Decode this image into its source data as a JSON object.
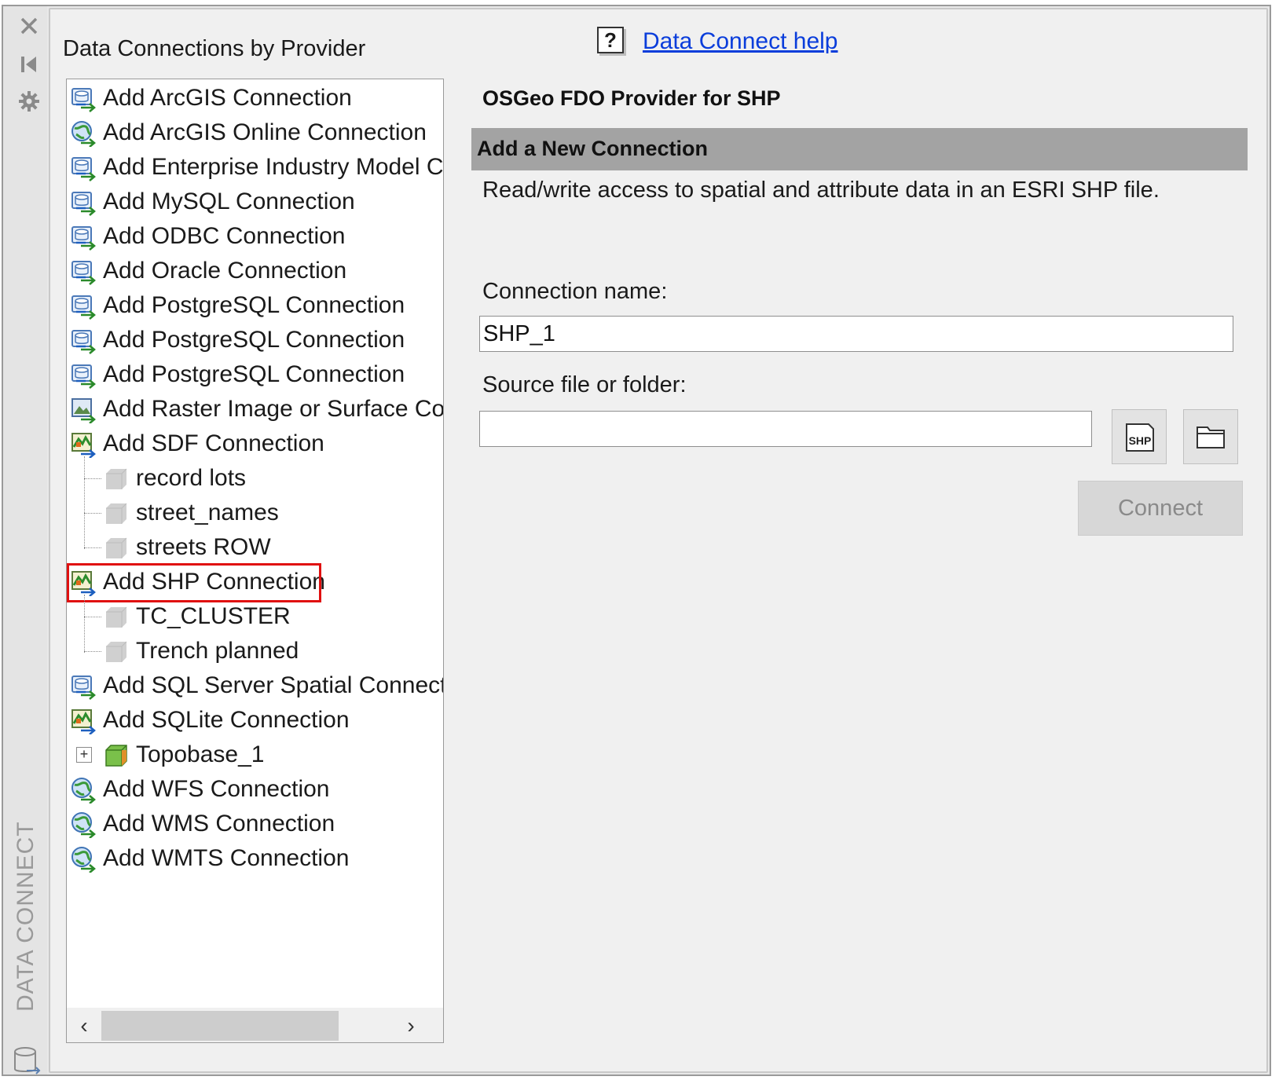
{
  "sidebar": {
    "vertical_title": "DATA CONNECT",
    "close_glyph": "✕"
  },
  "panel": {
    "title": "Data Connections by Provider",
    "help_glyph": "?",
    "help_link": "Data Connect help"
  },
  "tree": {
    "items": [
      {
        "label": "Add ArcGIS Connection",
        "icon": "db-connection-icon",
        "level": 0
      },
      {
        "label": "Add ArcGIS Online Connection",
        "icon": "globe-connection-icon",
        "level": 0
      },
      {
        "label": "Add Enterprise Industry Model C",
        "icon": "db-connection-icon",
        "level": 0
      },
      {
        "label": "Add MySQL Connection",
        "icon": "db-connection-icon",
        "level": 0
      },
      {
        "label": "Add ODBC Connection",
        "icon": "db-connection-icon",
        "level": 0
      },
      {
        "label": "Add Oracle Connection",
        "icon": "db-connection-icon",
        "level": 0
      },
      {
        "label": "Add PostgreSQL Connection",
        "icon": "db-connection-icon",
        "level": 0
      },
      {
        "label": "Add PostgreSQL Connection",
        "icon": "db-connection-icon",
        "level": 0
      },
      {
        "label": "Add PostgreSQL Connection",
        "icon": "db-connection-icon",
        "level": 0
      },
      {
        "label": "Add Raster Image or Surface Cor",
        "icon": "raster-connection-icon",
        "level": 0
      },
      {
        "label": "Add SDF Connection",
        "icon": "file-connection-icon",
        "level": 0
      },
      {
        "label": "record lots",
        "icon": "layer-cube-icon",
        "level": 1
      },
      {
        "label": "street_names",
        "icon": "layer-cube-icon",
        "level": 1
      },
      {
        "label": "streets ROW",
        "icon": "layer-cube-icon",
        "level": 1
      },
      {
        "label": "Add SHP Connection",
        "icon": "file-connection-icon",
        "level": 0,
        "selected": true
      },
      {
        "label": "TC_CLUSTER",
        "icon": "layer-cube-icon",
        "level": 1
      },
      {
        "label": "Trench planned",
        "icon": "layer-cube-icon",
        "level": 1
      },
      {
        "label": "Add SQL Server Spatial Connecti",
        "icon": "db-connection-icon",
        "level": 0
      },
      {
        "label": "Add SQLite Connection",
        "icon": "file-connection-icon",
        "level": 0
      },
      {
        "label": "Topobase_1",
        "icon": "green-cube-icon",
        "level": 1,
        "expander": "+"
      },
      {
        "label": "Add WFS Connection",
        "icon": "globe-connection-icon",
        "level": 0
      },
      {
        "label": "Add WMS Connection",
        "icon": "globe-connection-icon",
        "level": 0
      },
      {
        "label": "Add WMTS Connection",
        "icon": "globe-connection-icon",
        "level": 0
      }
    ],
    "scroll_left": "‹",
    "scroll_right": "›"
  },
  "detail": {
    "provider_title": "OSGeo FDO Provider for SHP",
    "section_title": "Add a New Connection",
    "description": "Read/write access to spatial and attribute data in an ESRI SHP file.",
    "connection_name_label": "Connection name:",
    "connection_name_value": "SHP_1",
    "source_label": "Source file or folder:",
    "source_value": "",
    "shp_button_text": "SHP",
    "connect_label": "Connect"
  },
  "colors": {
    "selection_outline": "#e01010",
    "link": "#0a3ddb",
    "section_bar": "#a3a3a3"
  }
}
